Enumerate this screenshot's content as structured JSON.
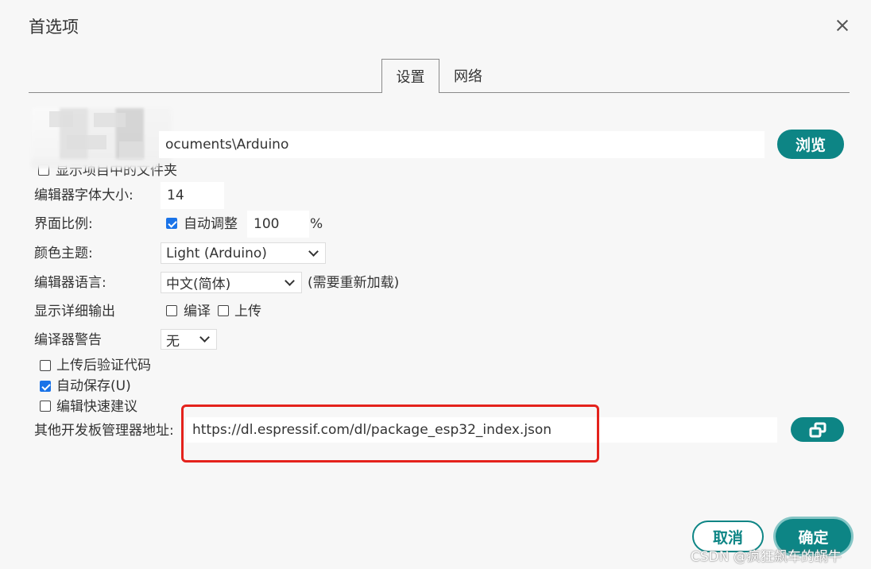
{
  "window": {
    "title": "首选项",
    "close_icon": "close-icon"
  },
  "tabs": [
    {
      "label": "设置",
      "active": true
    },
    {
      "label": "网络",
      "active": false
    }
  ],
  "settings": {
    "sketchbook": {
      "value": "ocuments\\Arduino",
      "browse_label": "浏览"
    },
    "show_sketch_files_label": "显示项目中的文件夹",
    "font_size": {
      "label": "编辑器字体大小:",
      "value": "14"
    },
    "scale": {
      "label": "界面比例:",
      "auto_label": "自动调整",
      "auto_checked": true,
      "value": "100",
      "unit": "%"
    },
    "theme": {
      "label": "颜色主题:",
      "value": "Light (Arduino)"
    },
    "language": {
      "label": "编辑器语言:",
      "value": "中文(简体)",
      "note": "(需要重新加载)"
    },
    "verbose": {
      "label": "显示详细输出",
      "compile_label": "编译",
      "compile_checked": false,
      "upload_label": "上传",
      "upload_checked": false
    },
    "warnings": {
      "label": "编译器警告",
      "value": "无"
    },
    "verify_after_upload": {
      "label": "上传后验证代码",
      "checked": false
    },
    "auto_save": {
      "label": "自动保存(U)",
      "checked": true
    },
    "quick_suggestions": {
      "label": "编辑快速建议",
      "checked": false
    },
    "board_urls": {
      "label": "其他开发板管理器地址:",
      "value": "https://dl.espressif.com/dl/package_esp32_index.json",
      "button_icon": "windows-icon"
    }
  },
  "footer": {
    "cancel_label": "取消",
    "ok_label": "确定"
  },
  "watermark": "CSDN @疯狂飙车的蜗牛",
  "colors": {
    "accent": "#0d8585",
    "highlight": "#e4221c",
    "checkbox": "#1a73e8"
  }
}
